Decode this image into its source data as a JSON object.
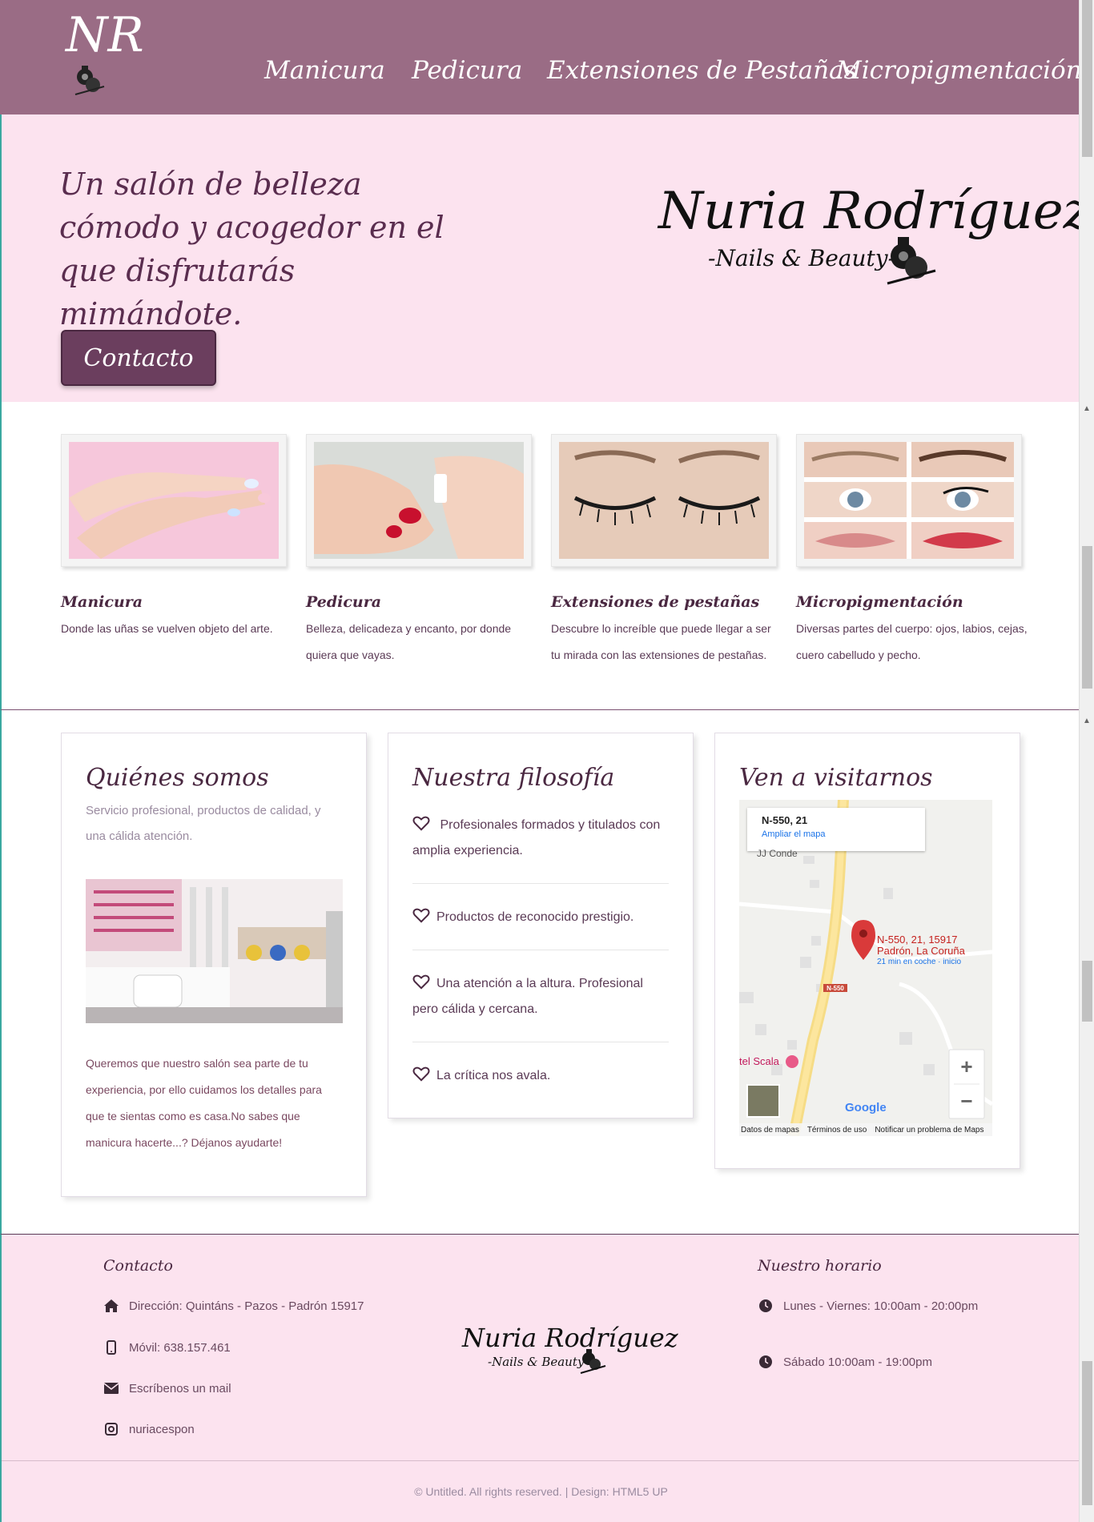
{
  "header": {
    "logo_mono": "NR",
    "nav": [
      {
        "label": "Manicura"
      },
      {
        "label": "Pedicura"
      },
      {
        "label": "Extensiones de Pestañas"
      },
      {
        "label": "Micropigmentación"
      }
    ]
  },
  "hero": {
    "tagline": "Un salón de belleza cómodo y acogedor en el que disfrutarás mimándote.",
    "contact_button": "Contacto",
    "brand_name": "Nuria Rodríguez",
    "brand_sub": "-Nails & Beauty-"
  },
  "services": [
    {
      "title": "Manicura",
      "desc": "Donde las uñas se vuelven objeto del arte."
    },
    {
      "title": "Pedicura",
      "desc": "Belleza, delicadeza y encanto, por donde quiera que vayas."
    },
    {
      "title": "Extensiones de pestañas",
      "desc": "Descubre lo increíble que puede llegar a ser tu mirada con las extensiones de pestañas."
    },
    {
      "title": "Micropigmentación",
      "desc": "Diversas partes del cuerpo: ojos, labios, cejas, cuero cabelludo y pecho."
    }
  ],
  "about": {
    "title": "Quiénes somos",
    "subtitle": "Servicio profesional, productos de calidad, y una cálida atención.",
    "text": "Queremos que nuestro salón sea parte de tu experiencia, por ello cuidamos los detalles para que te sientas como es casa.No sabes que manicura hacerte...? Déjanos ayudarte!"
  },
  "philosophy": {
    "title": "Nuestra filosofía",
    "items": [
      " Profesionales formados y titulados con amplia experiencia.",
      "Productos de reconocido prestigio.",
      "Una atención a la altura. Profesional pero cálida y cercana.",
      "La crítica nos avala."
    ]
  },
  "visit": {
    "title": "Ven a visitarnos",
    "map": {
      "card_title": "N-550, 21",
      "card_link": "Ampliar el mapa",
      "place_near": "JJ Conde",
      "pin_line1": "N-550, 21, 15917",
      "pin_line2": "Padrón, La Coruña",
      "pin_line3": "21 min en coche · inicio",
      "road_label": "N-550",
      "hotel": "tel Scala",
      "google": "Google",
      "footer_links": [
        "Datos de mapas",
        "Términos de uso",
        "Notificar un problema de Maps"
      ],
      "zoom_in": "+",
      "zoom_out": "−"
    }
  },
  "footer": {
    "contact_title": "Contacto",
    "address": "Dirección: Quintáns - Pazos - Padrón 15917",
    "phone": "Móvil: 638.157.461",
    "email": "Escríbenos un mail",
    "instagram": "nuriacespon",
    "brand_name": "Nuria Rodríguez",
    "brand_sub": "-Nails & Beauty-",
    "hours_title": "Nuestro horario",
    "hours": [
      "Lunes - Viernes: 10:00am - 20:00pm",
      "Sábado 10:00am - 19:00pm"
    ],
    "copyright": "© Untitled. All rights reserved. | Design: HTML5 UP"
  }
}
